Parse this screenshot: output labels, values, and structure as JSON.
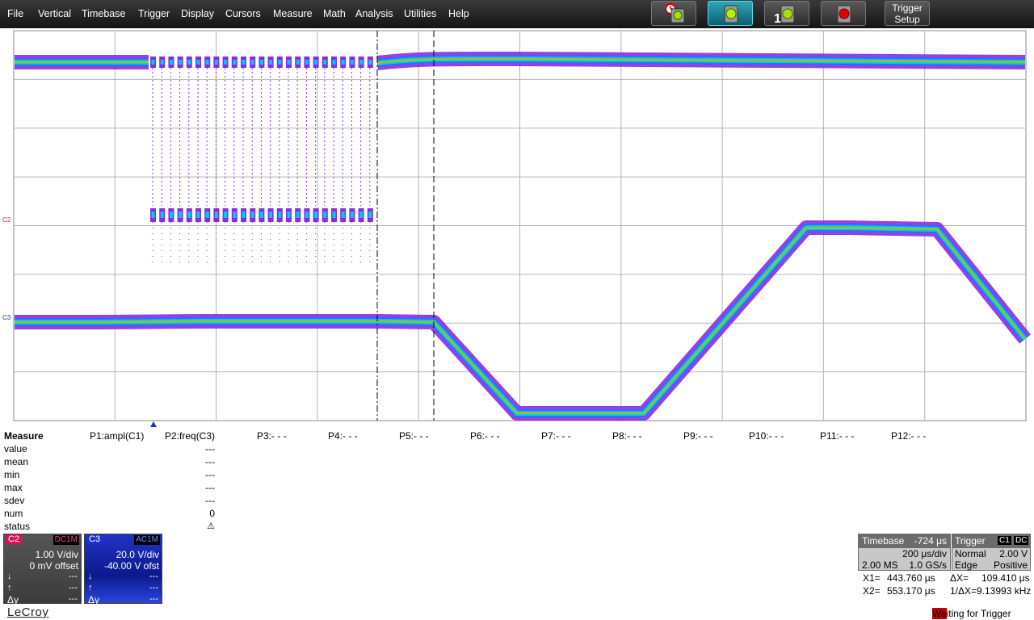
{
  "menu": [
    "File",
    "Vertical",
    "Timebase",
    "Trigger",
    "Display",
    "Cursors",
    "Measure",
    "Math",
    "Analysis",
    "Utilities",
    "Help"
  ],
  "toolbar": {
    "buttons": [
      "auto-trigger-mode",
      "normal-trigger-mode",
      "single-trigger-mode",
      "stop-trigger-mode"
    ],
    "single_label": "1",
    "trigger_setup_line1": "Trigger",
    "trigger_setup_line2": "Setup"
  },
  "grid": {
    "markers": {
      "c2": "C2",
      "c3": "C3"
    }
  },
  "measure": {
    "header": "Measure",
    "columns": [
      "P1:ampl(C1)",
      "P2:freq(C3)",
      "P3:- - -",
      "P4:- - -",
      "P5:- - -",
      "P6:- - -",
      "P7:- - -",
      "P8:- - -",
      "P9:- - -",
      "P10:- - -",
      "P11:- - -",
      "P12:- - -"
    ],
    "rows": [
      "value",
      "mean",
      "min",
      "max",
      "sdev",
      "num",
      "status"
    ],
    "p2_values": [
      "---",
      "---",
      "---",
      "---",
      "---",
      "0",
      "⚠"
    ]
  },
  "channels": [
    {
      "tag": "C2",
      "coupling": "DC1M",
      "vdiv": "1.00 V/div",
      "offset": "0 mV offset",
      "color": "#d4145a",
      "bg": "#4a4a4a"
    },
    {
      "tag": "C3",
      "coupling": "AC1M",
      "vdiv": "20.0 V/div",
      "offset": "-40.00 V ofst",
      "color": "#1a2fd6",
      "bg": "#1a28b8"
    }
  ],
  "dy_label": "Δy",
  "dash": "---",
  "timebase": {
    "label": "Timebase",
    "delay": "-724 μs",
    "per_div": "200 μs/div",
    "samples": "2.00 MS",
    "rate": "1.0 GS/s"
  },
  "trigger": {
    "label": "Trigger",
    "source": "C1",
    "coupling": "DC",
    "mode": "Normal",
    "level": "2.00 V",
    "type": "Edge",
    "slope": "Positive"
  },
  "cursors": {
    "x1_label": "X1=",
    "x1": "443.760 μs",
    "dx_label": "ΔX=",
    "dx": "109.410 μs",
    "x2_label": "X2=",
    "x2": "553.170 μs",
    "inv_label": "1/ΔX=",
    "inv": "9.13993 kHz"
  },
  "logo": "LeCroy",
  "status": {
    "highlight": "Wa",
    "rest": "iting for Trigger"
  },
  "colors": {
    "menubar": "#1e1e1e",
    "active_button": "#0b5f70",
    "trace_outer": "#8a2be2",
    "trace_mid": "#00c8ff",
    "trace_core": "#e8b000"
  }
}
